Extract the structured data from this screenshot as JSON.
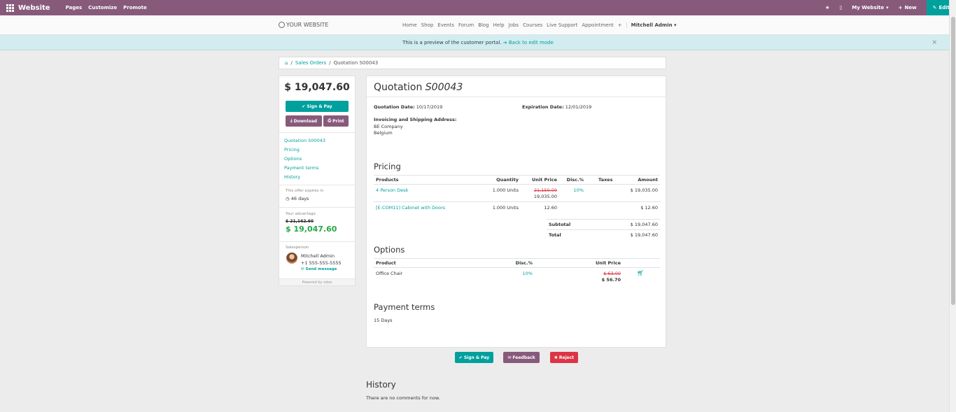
{
  "topbar": {
    "brand": "Website",
    "menu": [
      "Pages",
      "Customize",
      "Promote"
    ],
    "my_website": "My Website",
    "new": "New",
    "edit": "Edit"
  },
  "sitenav": {
    "logo": "YOUR WEBSITE",
    "links": [
      "Home",
      "Shop",
      "Events",
      "Forum",
      "Blog",
      "Help",
      "Jobs",
      "Courses",
      "Live Support",
      "Appointment"
    ],
    "plus": "+",
    "user": "Mitchell Admin"
  },
  "banner": {
    "text": "This is a preview of the customer portal.",
    "link": "Back to edit mode"
  },
  "breadcrumb": {
    "sep": "/",
    "sales_orders": "Sales Orders",
    "current": "Quotation S00043"
  },
  "sidebar": {
    "total": "$ 19,047.60",
    "sign_pay": "Sign & Pay",
    "download": "Download",
    "print": "Print",
    "links": [
      "Quotation S00043",
      "Pricing",
      "Options",
      "Payment terms",
      "History"
    ],
    "expires_label": "This offer expires in",
    "expires_value": "46 days",
    "advantage_label": "Your advantage",
    "old_price": "$ 21,162.60",
    "new_price": "$ 19,047.60",
    "salesperson_label": "Salesperson",
    "salesperson_name": "Mitchell Admin",
    "salesperson_phone": "+1 555-555-5555",
    "send_message": "Send message",
    "powered_by": "Powered by",
    "powered_brand": "odoo"
  },
  "quote": {
    "title_prefix": "Quotation",
    "number": "S00043",
    "quotation_date_label": "Quotation Date:",
    "quotation_date": "10/17/2019",
    "expiration_date_label": "Expiration Date:",
    "expiration_date": "12/01/2019",
    "address_label": "Invoicing and Shipping Address:",
    "address_lines": [
      "BE Company",
      "Belgium"
    ]
  },
  "pricing": {
    "heading": "Pricing",
    "columns": [
      "Products",
      "Quantity",
      "Unit Price",
      "Disc.%",
      "Taxes",
      "Amount"
    ],
    "rows": [
      {
        "product": "4 Person Desk",
        "quantity": "1.000 Units",
        "old_price": "21,150.00",
        "unit_price": "19,035.00",
        "discount": "10%",
        "taxes": "",
        "amount": "$ 19,035.00"
      },
      {
        "product": "[E-COM11] Cabinet with Doors",
        "quantity": "1.000 Units",
        "old_price": "",
        "unit_price": "12.60",
        "discount": "",
        "taxes": "",
        "amount": "$ 12.60"
      }
    ],
    "subtotal_label": "Subtotal",
    "subtotal": "$ 19,047.60",
    "total_label": "Total",
    "total": "$ 19,047.60"
  },
  "options": {
    "heading": "Options",
    "columns": [
      "Product",
      "Disc.%",
      "Unit Price"
    ],
    "rows": [
      {
        "product": "Office Chair",
        "discount": "10%",
        "old_price": "$ 63.00",
        "price": "$ 56.70"
      }
    ]
  },
  "payment_terms": {
    "heading": "Payment terms",
    "text": "15 Days"
  },
  "actions": {
    "sign_pay": "Sign & Pay",
    "feedback": "Feedback",
    "reject": "Reject"
  },
  "history": {
    "heading": "History",
    "text": "There are no comments for now."
  },
  "colors": {
    "brand": "#875A7B",
    "accent": "#00A09D",
    "danger": "#dc3545",
    "success": "#28a745"
  }
}
